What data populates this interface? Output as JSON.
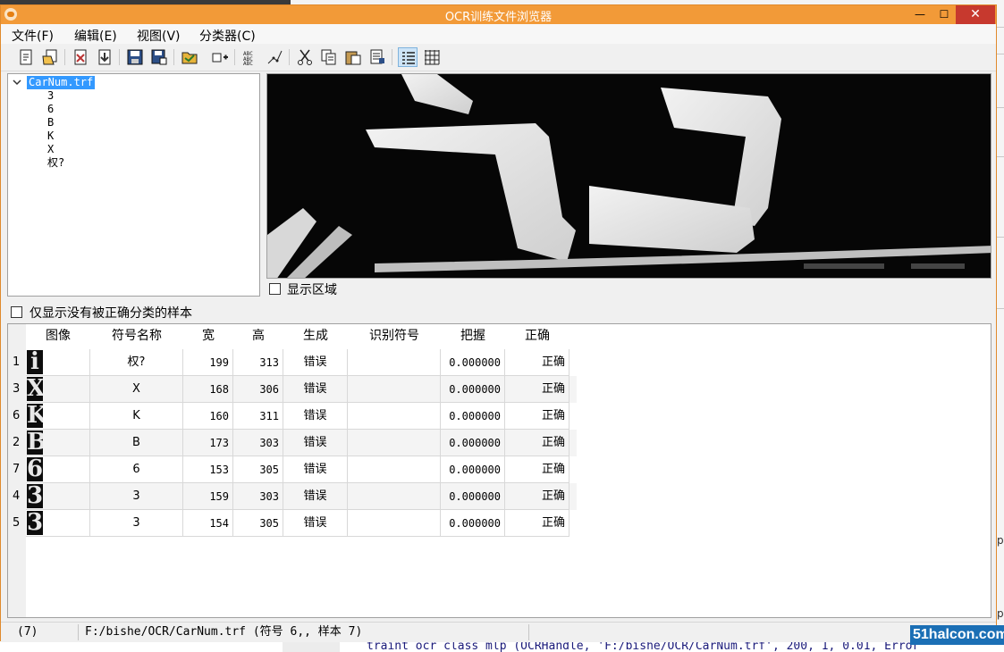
{
  "window": {
    "title": "OCR训练文件浏览器",
    "close_glyph": "✕",
    "min_glyph": "—",
    "max_glyph": "☐"
  },
  "menu": [
    "文件(F)",
    "编辑(E)",
    "视图(V)",
    "分类器(C)"
  ],
  "toolbar_icons": [
    "new-file-icon",
    "open-file-icon",
    "import-icon",
    "export-icon",
    "save-icon",
    "save-as-icon",
    "open-folder-icon",
    "add-sample-icon",
    "abc-text-icon",
    "edit-points-icon",
    "cut-icon",
    "copy-icon",
    "paste-icon",
    "delete-icon",
    "list-view-icon",
    "grid-view-icon"
  ],
  "tree": {
    "root": "CarNum.trf",
    "items": [
      "3",
      "6",
      "B",
      "K",
      "X",
      "权?"
    ]
  },
  "image_view": {
    "show_area_label": "显示区域"
  },
  "filter_label": "仅显示没有被正确分类的样本",
  "table": {
    "headers": [
      "图像",
      "符号名称",
      "宽",
      "高",
      "生成",
      "识别符号",
      "把握",
      "正确"
    ],
    "rows": [
      {
        "index": "1",
        "thumb": "i",
        "symbol": "权?",
        "width": "199",
        "height": "313",
        "generated": "错误",
        "recognized": "",
        "confidence": "0.000000",
        "correct": "正确"
      },
      {
        "index": "3",
        "thumb": "X",
        "symbol": "X",
        "width": "168",
        "height": "306",
        "generated": "错误",
        "recognized": "",
        "confidence": "0.000000",
        "correct": "正确"
      },
      {
        "index": "6",
        "thumb": "K",
        "symbol": "K",
        "width": "160",
        "height": "311",
        "generated": "错误",
        "recognized": "",
        "confidence": "0.000000",
        "correct": "正确"
      },
      {
        "index": "2",
        "thumb": "B",
        "symbol": "B",
        "width": "173",
        "height": "303",
        "generated": "错误",
        "recognized": "",
        "confidence": "0.000000",
        "correct": "正确"
      },
      {
        "index": "7",
        "thumb": "6",
        "symbol": "6",
        "width": "153",
        "height": "305",
        "generated": "错误",
        "recognized": "",
        "confidence": "0.000000",
        "correct": "正确"
      },
      {
        "index": "4",
        "thumb": "3",
        "symbol": "3",
        "width": "159",
        "height": "303",
        "generated": "错误",
        "recognized": "",
        "confidence": "0.000000",
        "correct": "正确"
      },
      {
        "index": "5",
        "thumb": "3",
        "symbol": "3",
        "width": "154",
        "height": "305",
        "generated": "错误",
        "recognized": "",
        "confidence": "0.000000",
        "correct": "正确"
      }
    ]
  },
  "status": {
    "count": "(7)",
    "path": "F:/bishe/OCR/CarNum.trf (符号 6,, 样本 7)"
  },
  "background": {
    "code_line": "traint ocr class mlp (OCRHandle, 'F:/bishe/OCR/CarNum.trf', 200, 1, 0.01, Error",
    "right_p": "p"
  },
  "watermark": "51halcon.com",
  "colors": {
    "titlebar": "#f29a38",
    "close": "#c7392e",
    "selection": "#3399ff"
  }
}
